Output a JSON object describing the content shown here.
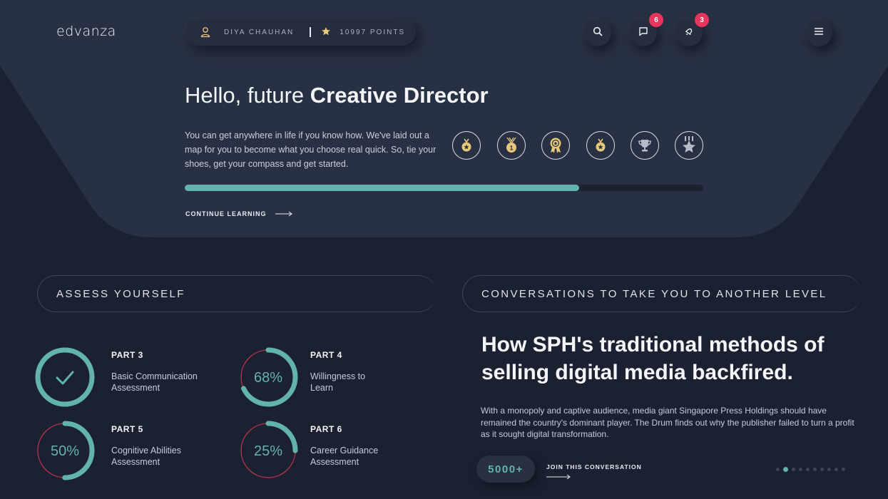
{
  "app": {
    "logo": "edvanza"
  },
  "user": {
    "name": "DIYA CHAUHAN",
    "points": "10997 POINTS"
  },
  "notifications": {
    "messages_count": "6",
    "alerts_count": "3"
  },
  "hero": {
    "greeting": "Hello, future ",
    "role": "Creative Director",
    "text": "You can get anywhere in life if you know how. We've laid out a map for you to become what you choose real quick. So, tie your shoes, get your compass and get started.",
    "progress_percent": 76,
    "continue_label": "CONTINUE LEARNING",
    "medals": [
      "star-medal-icon",
      "first-place-medal-icon",
      "award-medal-icon",
      "star-medal-icon",
      "trophy-icon",
      "star-badge-icon"
    ]
  },
  "assess": {
    "heading": "ASSESS YOURSELF",
    "parts": [
      {
        "title": "PART 3",
        "desc_line1": "Basic Communication",
        "desc_line2": "Assessment",
        "percent": 100,
        "label": "",
        "done": true
      },
      {
        "title": "PART 4",
        "desc_line1": "Willingness to",
        "desc_line2": "Learn",
        "percent": 68,
        "label": "68%",
        "done": false
      },
      {
        "title": "PART 5",
        "desc_line1": "Cognitive Abilities",
        "desc_line2": "Assessment",
        "percent": 50,
        "label": "50%",
        "done": false
      },
      {
        "title": "PART 6",
        "desc_line1": "Career Guidance",
        "desc_line2": "Assessment",
        "percent": 25,
        "label": "25%",
        "done": false
      }
    ]
  },
  "conversations": {
    "heading": "CONVERSATIONS TO TAKE YOU TO ANOTHER LEVEL",
    "article_title": "How SPH's traditional methods of selling digital media backfired.",
    "article_text": "With a monopoly and captive audience, media giant Singapore Press Holdings should have remained the country's dominant player. The Drum finds out why the publisher failed to turn a profit as it sought digital transformation.",
    "participants": "5000+",
    "join_label": "JOIN THIS CONVERSATION",
    "pagination_total": 10,
    "pagination_active": 2
  },
  "colors": {
    "accent": "#62b3ad",
    "danger": "#e9345b",
    "background": "#1b2130",
    "hero": "#283143"
  }
}
